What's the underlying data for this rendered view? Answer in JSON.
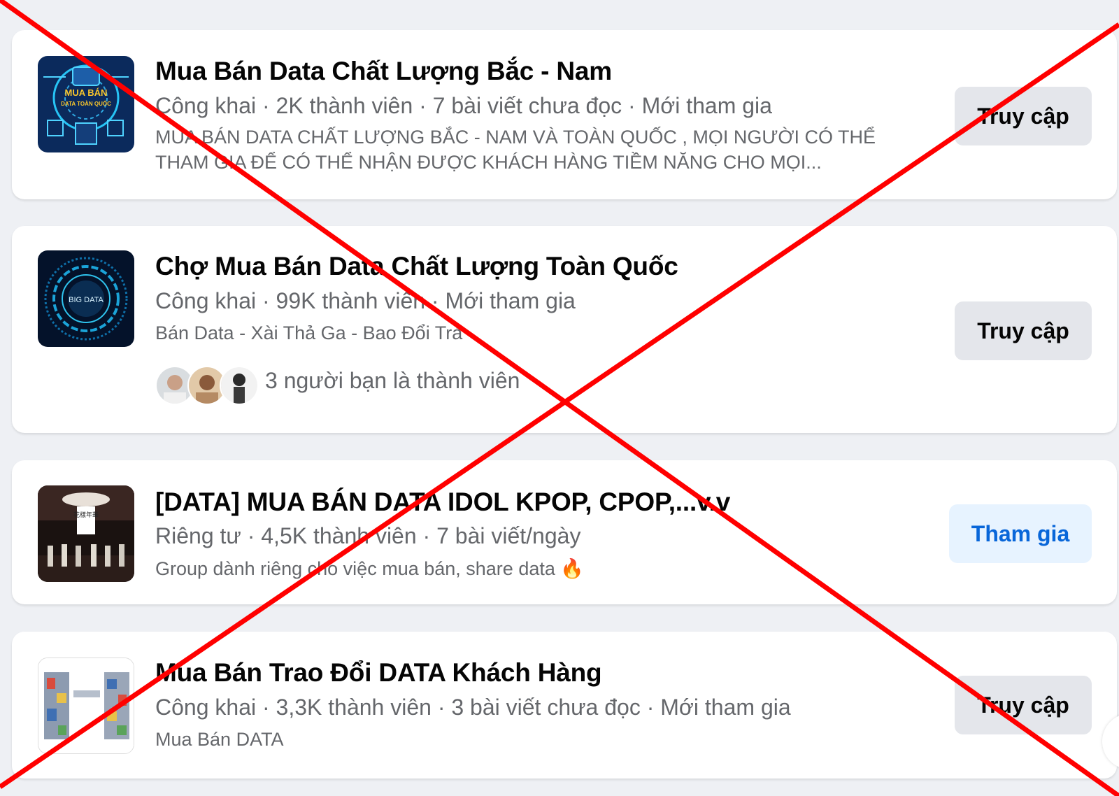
{
  "groups": [
    {
      "title": "Mua Bán Data Chất Lượng Bắc - Nam",
      "meta": "Công khai · 2K thành viên · 7 bài viết chưa đọc · Mới tham gia",
      "description_line1": "MUA BÁN DATA CHẤT LƯỢNG BẮC - NAM VÀ TOÀN QUỐC , MỌI NGƯỜI CÓ THỂ",
      "description_line2": "THAM GIA ĐỂ CÓ THỂ NHẬN ĐƯỢC KHÁCH HÀNG TIỀM NĂNG CHO MỌI...",
      "thumb_text_1": "MUA BÁN",
      "thumb_text_2": "DATA TOÀN QUỐC",
      "button": "Truy cập"
    },
    {
      "title": "Chợ Mua Bán Data Chất Lượng Toàn Quốc",
      "meta": "Công khai · 99K thành viên · Mới tham gia",
      "description": "Bán Data - Xài Thả Ga - Bao Đổi Trả",
      "thumb_text": "BIG DATA",
      "friends_text": "3 người bạn là thành viên",
      "button": "Truy cập"
    },
    {
      "title": "[DATA] MUA BÁN DATA IDOL KPOP, CPOP,...v.v",
      "meta": "Riêng tư · 4,5K thành viên · 7 bài viết/ngày",
      "description": "Group dành riêng cho việc mua bán, share data 🔥",
      "thumb_text": "花樣年華",
      "button": "Tham gia"
    },
    {
      "title": "Mua Bán Trao Đổi DATA Khách Hàng",
      "meta": "Công khai · 3,3K thành viên · 3 bài viết chưa đọc · Mới tham gia",
      "description": "Mua Bán DATA",
      "button": "Truy cập"
    }
  ],
  "colors": {
    "background": "#eef0f4",
    "card": "#ffffff",
    "title": "#050505",
    "secondary_text": "#65676b",
    "gray_button": "#e4e6eb",
    "blue_button_bg": "#e7f3ff",
    "blue_button_text": "#0866d9",
    "cross": "#ff0000"
  },
  "icons": [
    "group-thumbnail",
    "friend-avatar",
    "fire-emoji",
    "red-x-overlay"
  ]
}
